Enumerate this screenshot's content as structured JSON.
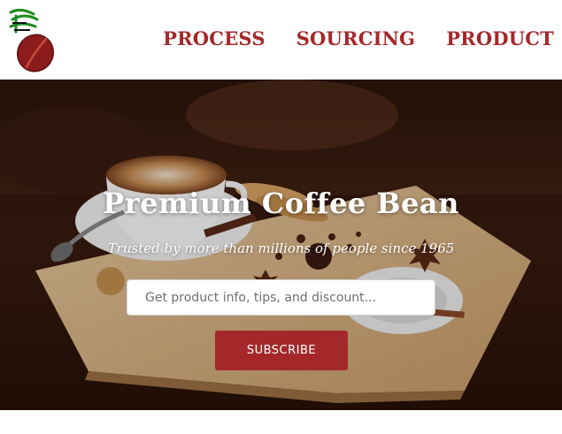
{
  "header": {
    "logo_icon": "coffee-bean-logo-icon",
    "nav": [
      {
        "label": "PROCESS"
      },
      {
        "label": "SOURCING"
      },
      {
        "label": "PRODUCT"
      }
    ]
  },
  "hero": {
    "title": "Premium Coffee Bean",
    "subtitle": "Trusted by more than millions of people since 1965",
    "email_placeholder": "Get product info, tips, and discount...",
    "email_value": "",
    "subscribe_label": "SUBSCRIBE",
    "photo": "coffee-cup-on-wooden-board-image"
  },
  "colors": {
    "accent": "#a4282a",
    "logo_green": "#1f8a1f",
    "bean_red": "#8c1c1c",
    "text_light": "#ffffff"
  }
}
